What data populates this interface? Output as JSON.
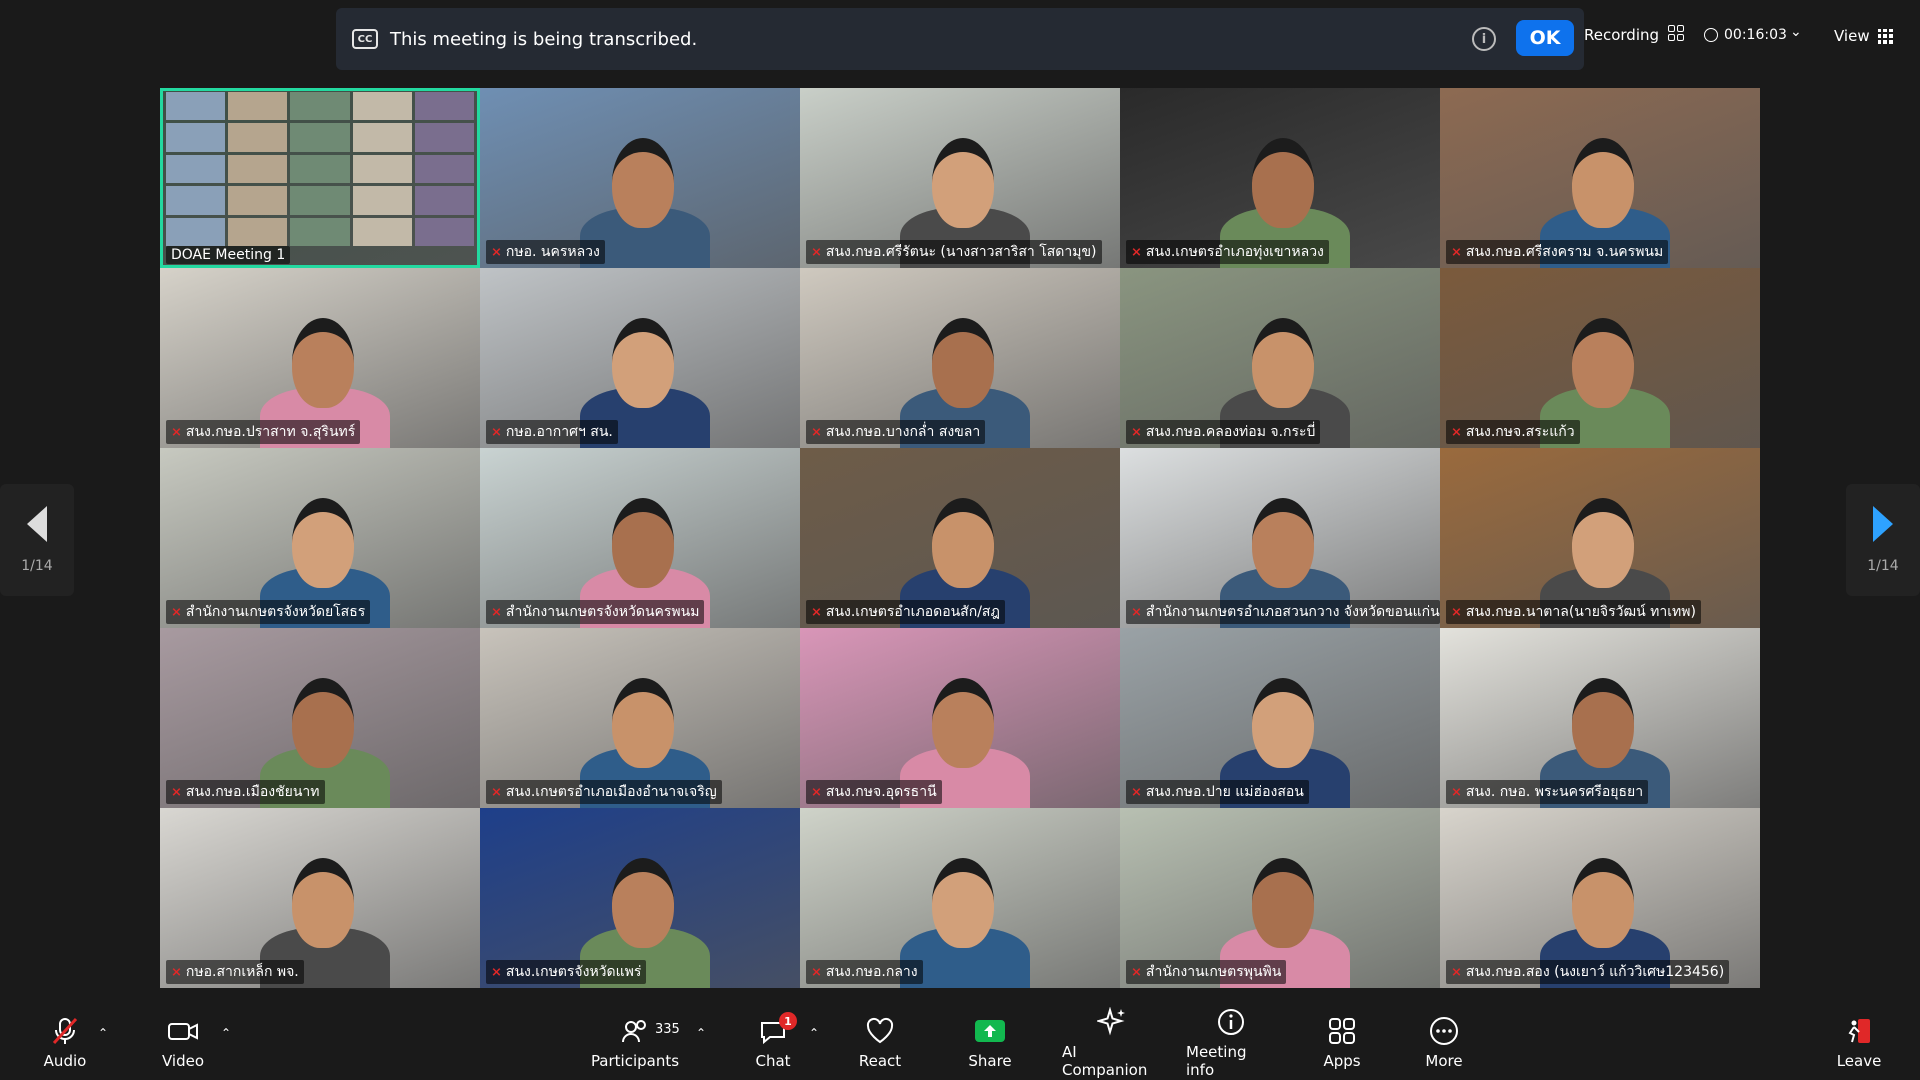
{
  "banner": {
    "cc_icon": "CC",
    "text": "This meeting is being transcribed.",
    "ok_label": "OK"
  },
  "topbar": {
    "recording_label": "Recording",
    "timer": "00:16:03",
    "view_label": "View"
  },
  "pager": {
    "page_label": "1/14"
  },
  "tiles": [
    {
      "name": "DOAE Meeting 1",
      "bg": "#3d4f45",
      "active": true
    },
    {
      "name": "กษอ. นครหลวง",
      "bg": "#6f8fb3"
    },
    {
      "name": "สนง.กษอ.ศรีรัตนะ (นางสาวสาริสา โสดามุข)",
      "bg": "#c9cfc8"
    },
    {
      "name": "สนง.เกษตรอำเภอทุ่งเขาหลวง",
      "bg": "#2a2a2a"
    },
    {
      "name": "สนง.กษอ.ศรีสงคราม จ.นครพนม",
      "bg": "#8d6a52"
    },
    {
      "name": "สนง.กษอ.ปราสาท จ.สุรินทร์",
      "bg": "#d6d2c9"
    },
    {
      "name": "กษอ.อากาศฯ สน.",
      "bg": "#bfc3c6"
    },
    {
      "name": "สนง.กษอ.บางกล่ำ สงขลา",
      "bg": "#cfc9bf"
    },
    {
      "name": "สนง.กษอ.คลองท่อม จ.กระบี่",
      "bg": "#8a9580"
    },
    {
      "name": "สนง.กษจ.สระแก้ว",
      "bg": "#7b5a3c"
    },
    {
      "name": "สำนักงานเกษตรจังหวัดยโสธร",
      "bg": "#c7c9c0"
    },
    {
      "name": "สำนักงานเกษตรจังหวัดนครพนม",
      "bg": "#c9d3d2"
    },
    {
      "name": "สนง.เกษตรอำเภอดอนสัก/สฎ",
      "bg": "#6e5c48"
    },
    {
      "name": "สำนักงานเกษตรอำเภอสวนกวาง จังหวัดขอนแก่น",
      "bg": "#dcdfe0"
    },
    {
      "name": "สนง.กษอ.นาตาล(นายจิรวัฒน์ ทาเทพ)",
      "bg": "#9a6a3d"
    },
    {
      "name": "สนง.กษอ.เมืองชัยนาท",
      "bg": "#a89aa0"
    },
    {
      "name": "สนง.เกษตรอำเภอเมืองอำนาจเจริญ",
      "bg": "#c8c3bb"
    },
    {
      "name": "สนง.กษจ.อุดรธานี",
      "bg": "#d996b8"
    },
    {
      "name": "สนง.กษอ.ปาย แม่ฮ่องสอน",
      "bg": "#9aa2a6"
    },
    {
      "name": "สนง. กษอ. พระนครศรีอยุธยา",
      "bg": "#e3e2dc"
    },
    {
      "name": "กษอ.สากเหล็ก พจ.",
      "bg": "#d9d7d2"
    },
    {
      "name": "สนง.เกษตรจังหวัดแพร่",
      "bg": "#1e3f8a"
    },
    {
      "name": "สนง.กษอ.กลาง",
      "bg": "#cfd3c9"
    },
    {
      "name": "สำนักงานเกษตรพุนพิน",
      "bg": "#b8c0b2"
    },
    {
      "name": "สนง.กษอ.สอง (นงเยาว์ แก้ววิเศษ123456)",
      "bg": "#d8d4cc"
    }
  ],
  "toolbar": {
    "audio": "Audio",
    "video": "Video",
    "participants": "Participants",
    "participants_count": "335",
    "chat": "Chat",
    "chat_badge": "1",
    "react": "React",
    "share": "Share",
    "ai_companion": "AI Companion",
    "meeting_info": "Meeting info",
    "apps": "Apps",
    "more": "More",
    "leave": "Leave"
  }
}
